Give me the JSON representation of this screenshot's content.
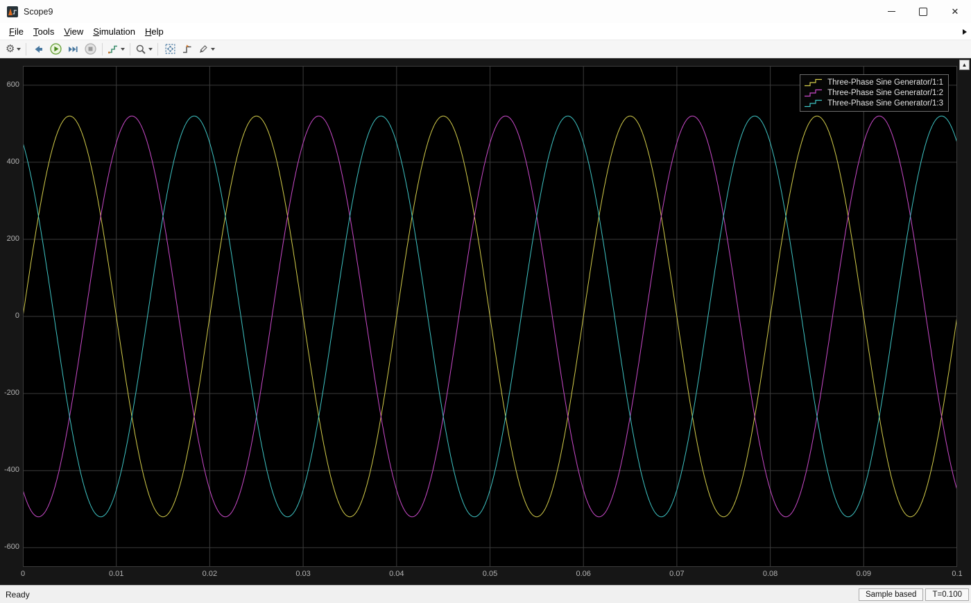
{
  "window": {
    "title": "Scope9",
    "controls": {
      "icons": [
        "minimize-icon",
        "maximize-icon",
        "close-icon"
      ],
      "close_glyph": "✕"
    }
  },
  "menu": {
    "items": [
      {
        "label": "File"
      },
      {
        "label": "Tools"
      },
      {
        "label": "View"
      },
      {
        "label": "Simulation"
      },
      {
        "label": "Help"
      }
    ]
  },
  "toolbar": {
    "buttons": [
      {
        "name": "settings",
        "icon": "gear-icon",
        "has_dropdown": true
      },
      {
        "name": "highlight-simulink-block",
        "icon": "back-arrow-icon",
        "has_dropdown": false
      },
      {
        "name": "run",
        "icon": "play-icon",
        "has_dropdown": false
      },
      {
        "name": "step-forward",
        "icon": "step-forward-icon",
        "has_dropdown": false
      },
      {
        "name": "stop",
        "icon": "stop-icon",
        "has_dropdown": false,
        "disabled": true
      },
      {
        "name": "signal-selector",
        "icon": "signal-steps-icon",
        "has_dropdown": true
      },
      {
        "name": "zoom",
        "icon": "magnifier-icon",
        "has_dropdown": true
      },
      {
        "name": "fit-to-view",
        "icon": "fit-to-view-icon",
        "has_dropdown": false
      },
      {
        "name": "trigger",
        "icon": "trigger-icon",
        "has_dropdown": false
      },
      {
        "name": "measurements",
        "icon": "highlighter-icon",
        "has_dropdown": true
      }
    ]
  },
  "status_bar": {
    "left_text": "Ready",
    "sample_mode": "Sample based",
    "time": "T=0.100"
  },
  "chart_data": {
    "type": "line",
    "title": "",
    "xlabel": "",
    "ylabel": "",
    "xlim": [
      0,
      0.1
    ],
    "ylim": [
      -650,
      650
    ],
    "x_ticks": [
      0,
      0.01,
      0.02,
      0.03,
      0.04,
      0.05,
      0.06,
      0.07,
      0.08,
      0.09,
      0.1
    ],
    "x_tick_labels": [
      "0",
      "0.01",
      "0.02",
      "0.03",
      "0.04",
      "0.05",
      "0.06",
      "0.07",
      "0.08",
      "0.09",
      "0.1"
    ],
    "y_ticks": [
      -600,
      -400,
      -200,
      0,
      200,
      400,
      600
    ],
    "y_tick_labels": [
      "-600",
      "-400",
      "-200",
      "0",
      "200",
      "400",
      "600"
    ],
    "grid": true,
    "grid_color": "#3b3b3b",
    "plot_background": "#000000",
    "legend_position": "top-right",
    "sample_time_s": 0.0001,
    "series": [
      {
        "name": "Three-Phase Sine Generator/1:1",
        "color": "#d6cf4b",
        "waveform": "sine",
        "amplitude": 520,
        "frequency_hz": 50,
        "phase_deg": 0
      },
      {
        "name": "Three-Phase Sine Generator/1:2",
        "color": "#cc4bcc",
        "waveform": "sine",
        "amplitude": 520,
        "frequency_hz": 50,
        "phase_deg": -120
      },
      {
        "name": "Three-Phase Sine Generator/1:3",
        "color": "#3fc6c6",
        "waveform": "sine",
        "amplitude": 520,
        "frequency_hz": 50,
        "phase_deg": 120
      }
    ]
  }
}
